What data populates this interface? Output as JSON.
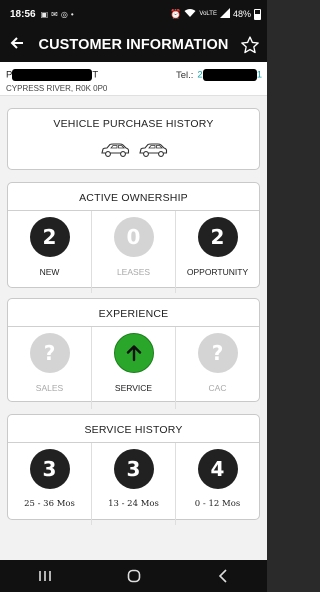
{
  "status": {
    "time": "18:56",
    "icons": [
      "gallery-icon",
      "mail-icon",
      "whatsapp-icon",
      "dot-icon"
    ],
    "signal_label": "VoLTE",
    "battery": "48%"
  },
  "appbar": {
    "title": "CUSTOMER INFORMATION",
    "back_icon": "arrow-left-icon",
    "favorite_icon": "star-outline-icon"
  },
  "customer": {
    "name_first_char": "P",
    "name_last_char": "T",
    "tel_label": "Tel.:",
    "tel_first_char": "2",
    "tel_last_char": "1",
    "address": "CYPRESS RIVER, R0K 0P0"
  },
  "vehicle_purchase_history": {
    "title": "VEHICLE PURCHASE HISTORY",
    "car_icons": [
      "car-icon",
      "car-icon"
    ]
  },
  "active_ownership": {
    "title": "ACTIVE OWNERSHIP",
    "items": [
      {
        "value": "2",
        "label": "NEW"
      },
      {
        "value": "0",
        "label": "LEASES"
      },
      {
        "value": "2",
        "label": "OPPORTUNITY"
      }
    ]
  },
  "experience": {
    "title": "EXPERIENCE",
    "items": [
      {
        "symbol": "?",
        "label": "SALES"
      },
      {
        "symbol": "↑",
        "label": "SERVICE"
      },
      {
        "symbol": "?",
        "label": "CAC"
      }
    ]
  },
  "service_history": {
    "title": "SERVICE HISTORY",
    "items": [
      {
        "value": "3",
        "label": "25 - 36 Mos"
      },
      {
        "value": "3",
        "label": "13 - 24 Mos"
      },
      {
        "value": "4",
        "label": "0 - 12 Mos"
      }
    ]
  },
  "colors": {
    "accent_teal": "#17a2a8",
    "green": "#2aa62a",
    "dark_circle": "#212121",
    "gray_circle": "#d4d4d4"
  }
}
